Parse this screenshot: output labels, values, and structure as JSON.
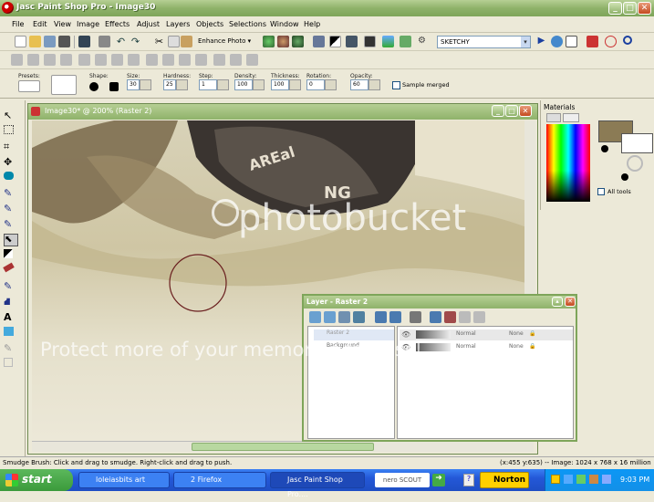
{
  "titlebar": {
    "title": "Jasc Paint Shop Pro - Image30",
    "min": "_",
    "max": "□",
    "close": "✕"
  },
  "menu": [
    "File",
    "Edit",
    "View",
    "Image",
    "Effects",
    "Adjust",
    "Layers",
    "Objects",
    "Selections",
    "Window",
    "Help"
  ],
  "toolbar": {
    "enhance_photo": "Enhance Photo",
    "preset_field": "SKETCHY"
  },
  "tool_options": {
    "presets_label": "Presets:",
    "shape_label": "Shape:",
    "size_label": "Size:",
    "size": "30",
    "hardness_label": "Hardness:",
    "hardness": "25",
    "step_label": "Step:",
    "step": "1",
    "density_label": "Density:",
    "density": "100",
    "thickness_label": "Thickness:",
    "thickness": "100",
    "rotation_label": "Rotation:",
    "rotation": "0",
    "opacity_label": "Opacity:",
    "opacity": "60",
    "sample_merged": "Sample merged"
  },
  "canvas": {
    "title": "Image30* @ 200% (Raster 2)"
  },
  "materials": {
    "title": "Materials",
    "all_tools": "All tools",
    "colors": {
      "foreground": "#8b7b55",
      "background": "#ffffff"
    }
  },
  "layers": {
    "title": "Layer - Raster 2",
    "rows": [
      {
        "name": "Raster 2",
        "blend": "Normal",
        "mask": "None"
      },
      {
        "name": "Background",
        "blend": "Normal",
        "mask": "None"
      }
    ]
  },
  "watermark": {
    "brand": "photobucket",
    "tagline": "Protect more of your memories for less!"
  },
  "status": {
    "hint": "Smudge Brush: Click and drag to smudge. Right-click and drag to push.",
    "info": "(x:455 y:635) -- Image:  1024 x 768 x 16 million"
  },
  "taskbar": {
    "start": "start",
    "tasks": [
      "loleiasbits art",
      "2 Firefox",
      "Jasc Paint Shop Pro...."
    ],
    "search": "nero SCOUT",
    "norton": "Norton",
    "clock": "9:03 PM"
  }
}
